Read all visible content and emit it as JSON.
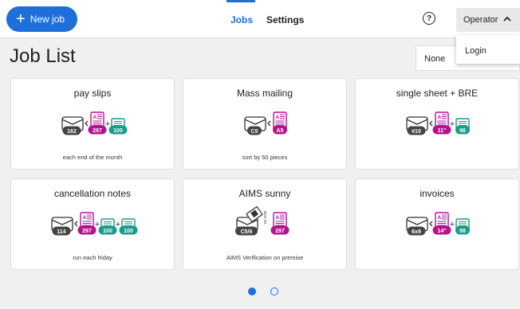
{
  "header": {
    "new_job_label": "New job",
    "tabs": [
      {
        "label": "Jobs",
        "active": true
      },
      {
        "label": "Settings",
        "active": false
      }
    ],
    "help_glyph": "?",
    "user_menu_label": "Operator",
    "user_menu_items": [
      "Login"
    ]
  },
  "page": {
    "title": "Job List",
    "filter_value": "None"
  },
  "jobs": [
    {
      "title": "pay slips",
      "description": "each end of the month",
      "envelope": "162",
      "document": "297",
      "inserts": [
        "100"
      ]
    },
    {
      "title": "Mass mailing",
      "description": "sort by 50 pieces",
      "envelope": "C5",
      "document": "A5",
      "inserts": []
    },
    {
      "title": "single sheet + BRE",
      "description": "",
      "envelope": "#10",
      "document": "11\"",
      "inserts": [
        "98"
      ]
    },
    {
      "title": "cancellation notes",
      "description": "run each friday",
      "envelope": "114",
      "document": "297",
      "inserts": [
        "100",
        "100"
      ]
    },
    {
      "title": "AIMS sunny",
      "description": "AIMS Verification on premise",
      "envelope": "C5/6",
      "document": "297",
      "inserts": [],
      "aims_tag": "BCR 2D"
    },
    {
      "title": "invoices",
      "description": "",
      "envelope": "6x9",
      "document": "14\"",
      "inserts": [
        "98"
      ]
    }
  ],
  "pagination": {
    "pages": 2,
    "current": 1
  },
  "colors": {
    "accent": "#1e6fd9",
    "document": "#b5128d",
    "insert": "#1a9b8b",
    "envelope_badge": "#444444"
  }
}
